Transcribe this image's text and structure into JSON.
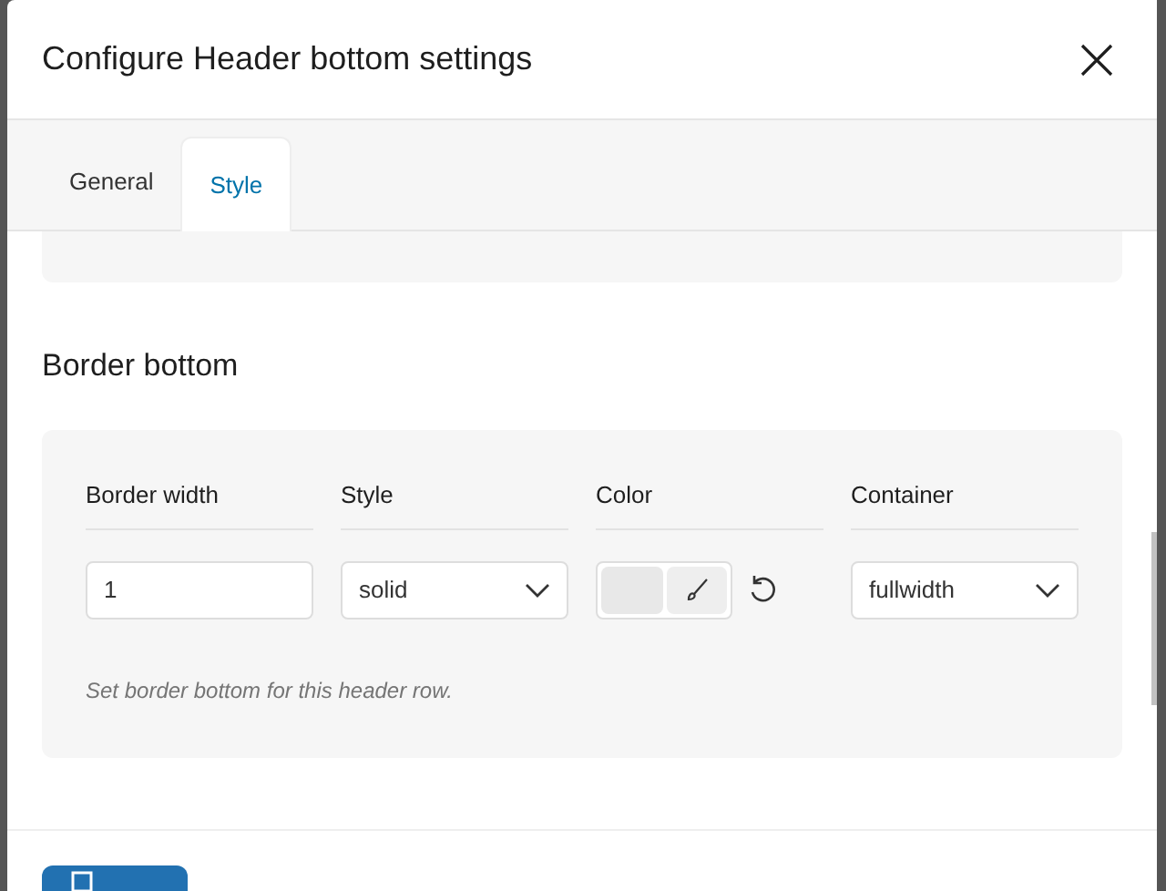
{
  "dialog": {
    "title": "Configure Header bottom settings"
  },
  "tabs": [
    {
      "label": "General",
      "selected": false
    },
    {
      "label": "Style",
      "selected": true
    }
  ],
  "section": {
    "heading": "Border bottom",
    "columns": [
      "Border width",
      "Style",
      "Color",
      "Container"
    ],
    "border_width": {
      "value": "1"
    },
    "style": {
      "value": "solid"
    },
    "container": {
      "value": "fullwidth"
    },
    "help": "Set border bottom for this header row."
  }
}
